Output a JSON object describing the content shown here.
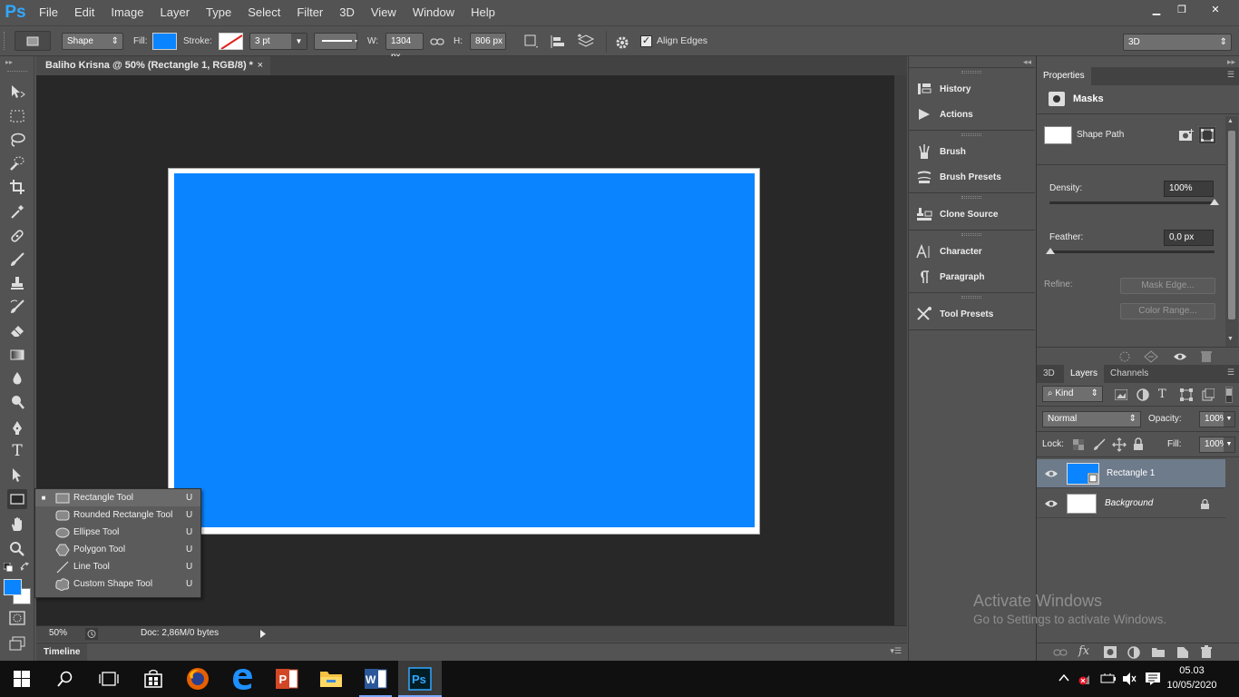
{
  "app": {
    "logo": "Ps"
  },
  "menu": [
    "File",
    "Edit",
    "Image",
    "Layer",
    "Type",
    "Select",
    "Filter",
    "3D",
    "View",
    "Window",
    "Help"
  ],
  "window_controls": {
    "minimize": "▁",
    "restore": "❐",
    "close": "✕"
  },
  "options_bar": {
    "mode_value": "Shape",
    "fill_label": "Fill:",
    "fill_color": "#0a85ff",
    "stroke_label": "Stroke:",
    "stroke_width": "3 pt",
    "w_label": "W:",
    "w_value": "1304 px",
    "h_label": "H:",
    "h_value": "806 px",
    "align_edges_label": "Align Edges",
    "align_edges_checked": true,
    "workspace": "3D"
  },
  "document": {
    "tab_title": "Baliho Krisna @ 50% (Rectangle 1, RGB/8) *",
    "tab_close": "×",
    "fill_color": "#0a85ff",
    "zoom": "50%",
    "doc_info": "Doc: 2,86M/0 bytes"
  },
  "timeline": {
    "label": "Timeline"
  },
  "tool_flyout": {
    "items": [
      {
        "label": "Rectangle Tool",
        "key": "U",
        "selected": true,
        "icon": "rectangle-icon"
      },
      {
        "label": "Rounded Rectangle Tool",
        "key": "U",
        "selected": false,
        "icon": "rounded-rectangle-icon"
      },
      {
        "label": "Ellipse Tool",
        "key": "U",
        "selected": false,
        "icon": "ellipse-icon"
      },
      {
        "label": "Polygon Tool",
        "key": "U",
        "selected": false,
        "icon": "polygon-icon"
      },
      {
        "label": "Line Tool",
        "key": "U",
        "selected": false,
        "icon": "line-icon"
      },
      {
        "label": "Custom Shape Tool",
        "key": "U",
        "selected": false,
        "icon": "custom-shape-icon"
      }
    ]
  },
  "colors": {
    "foreground": "#0a85ff",
    "background": "#ffffff"
  },
  "dock": {
    "history": "History",
    "actions": "Actions",
    "brush": "Brush",
    "brush_presets": "Brush Presets",
    "clone_source": "Clone Source",
    "character": "Character",
    "paragraph": "Paragraph",
    "tool_presets": "Tool Presets"
  },
  "properties": {
    "tab": "Properties",
    "section": "Masks",
    "shape_path": "Shape Path",
    "density_label": "Density:",
    "density_value": "100%",
    "density_fraction": 1.0,
    "feather_label": "Feather:",
    "feather_value": "0,0 px",
    "feather_fraction": 0.0,
    "refine_label": "Refine:",
    "mask_edge_btn": "Mask Edge...",
    "color_range_btn": "Color Range..."
  },
  "layers_panel": {
    "tabs": [
      "3D",
      "Layers",
      "Channels"
    ],
    "active_tab": "Layers",
    "kind": "Kind",
    "blend_mode": "Normal",
    "opacity_label": "Opacity:",
    "opacity_value": "100%",
    "lock_label": "Lock:",
    "fill_label": "Fill:",
    "fill_value": "100%",
    "layers": [
      {
        "name": "Rectangle 1",
        "selected": true,
        "thumb": "#0a85ff",
        "locked": false
      },
      {
        "name": "Background",
        "selected": false,
        "thumb": "#ffffff",
        "locked": true
      }
    ]
  },
  "watermark": {
    "title": "Activate Windows",
    "subtitle": "Go to Settings to activate Windows."
  },
  "taskbar": {
    "time": "05.03",
    "date": "10/05/2020"
  }
}
